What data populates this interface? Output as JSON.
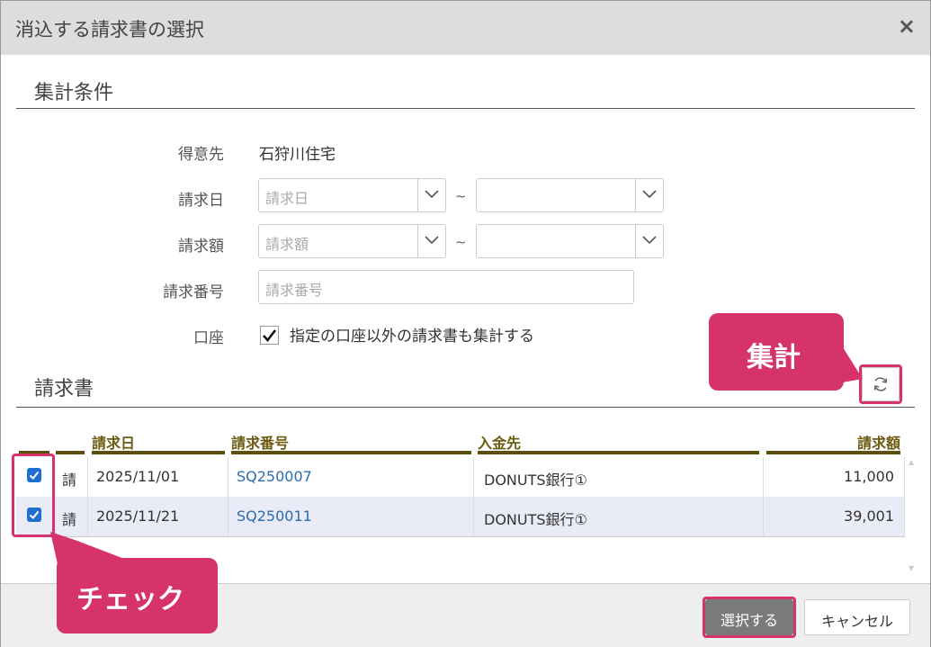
{
  "dialog": {
    "title": "消込する請求書の選択",
    "close_symbol": "×"
  },
  "conditions": {
    "section_title": "集計条件",
    "customer": {
      "label": "得意先",
      "value": "石狩川住宅"
    },
    "invoice_date": {
      "label": "請求日",
      "from_placeholder": "請求日",
      "to_placeholder": "",
      "tilde": "~"
    },
    "invoice_amount": {
      "label": "請求額",
      "from_placeholder": "請求額",
      "to_placeholder": "",
      "tilde": "~"
    },
    "invoice_number": {
      "label": "請求番号",
      "placeholder": "請求番号"
    },
    "account": {
      "label": "口座",
      "checkbox_label": "指定の口座以外の請求書も集計する",
      "checked": true
    }
  },
  "invoices": {
    "section_title": "請求書",
    "columns": [
      "",
      "",
      "請求日",
      "請求番号",
      "入金先",
      "請求額"
    ],
    "rows": [
      {
        "checked": true,
        "kind": "請",
        "date": "2025/11/01",
        "number": "SQ250007",
        "payee": "DONUTS銀行①",
        "amount": "11,000"
      },
      {
        "checked": true,
        "kind": "請",
        "date": "2025/11/21",
        "number": "SQ250011",
        "payee": "DONUTS銀行①",
        "amount": "39,001"
      }
    ]
  },
  "footer": {
    "select_label": "選択する",
    "cancel_label": "キャンセル"
  },
  "annotations": {
    "aggregate": "集計",
    "check": "チェック"
  },
  "colors": {
    "accent": "#d6336c",
    "header_rule": "#5e4f0f",
    "checkbox": "#1f6fd1",
    "link": "#2b6cb0"
  },
  "icons": {
    "refresh": "refresh-icon",
    "chevron": "chevron-down-icon",
    "close": "close-icon",
    "check": "check-icon"
  }
}
